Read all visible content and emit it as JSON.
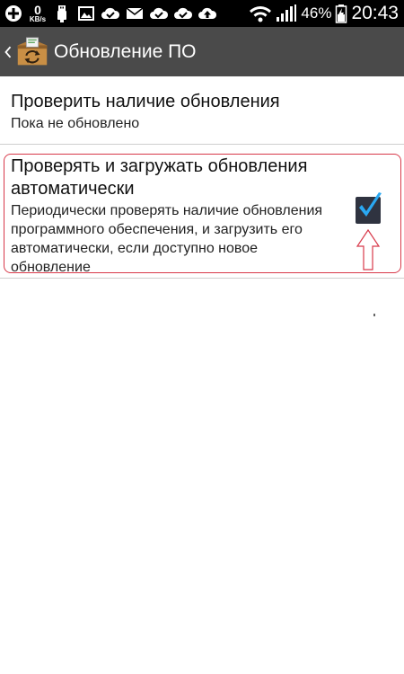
{
  "status_bar": {
    "net_speed": "0",
    "net_unit": "KB/s",
    "battery_percent": "46%",
    "time": "20:43",
    "icons": [
      "add-icon",
      "net-speed-indicator",
      "usb-icon",
      "gallery-icon",
      "cloud-check-icon",
      "mail-icon",
      "cloud-check-icon",
      "cloud-check-icon",
      "cloud-upload-icon",
      "wifi-icon",
      "signal-icon",
      "battery-charging-icon"
    ]
  },
  "action_bar": {
    "title": "Обновление ПО",
    "icon": "software-update-box-icon"
  },
  "prefs": {
    "check_update": {
      "title": "Проверить наличие обновления",
      "summary": "Пока не обновлено"
    },
    "auto_update": {
      "title": "Проверять и загружать обновления автоматически",
      "summary": "Периодически проверять наличие обновления программного обеспечения, и загрузить его автоматически, если доступно новое обновление",
      "checked": true
    }
  },
  "colors": {
    "status_bar_bg": "#000000",
    "action_bar_bg": "#4a4a4a",
    "highlight": "#d8394a",
    "check_blue": "#2aa8f2"
  }
}
